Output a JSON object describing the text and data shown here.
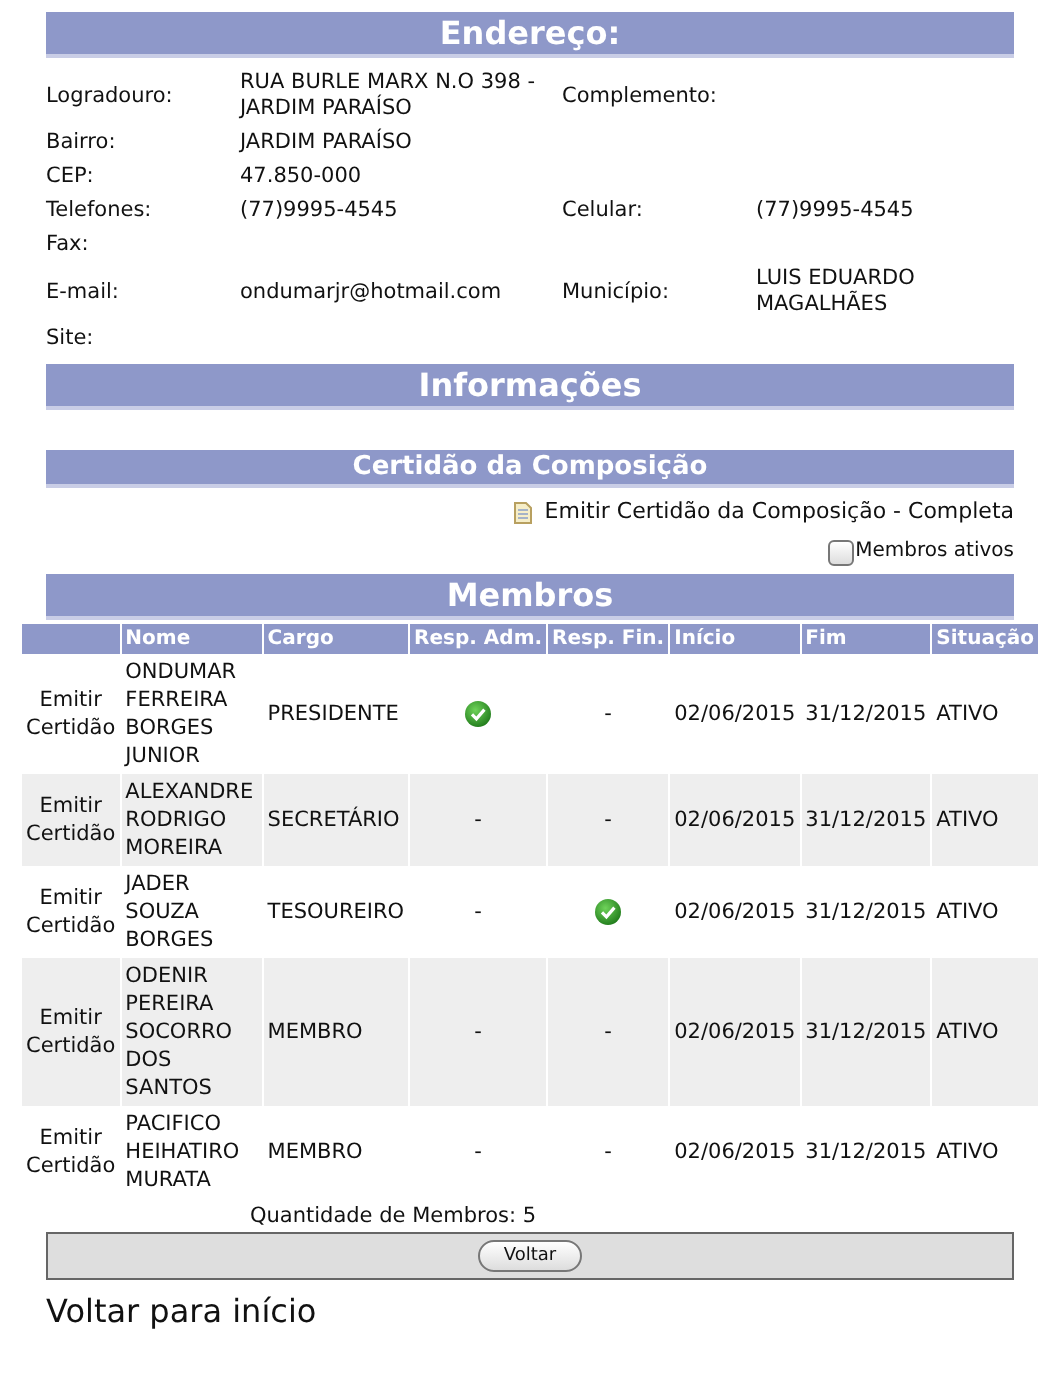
{
  "address": {
    "title": "Endereço:",
    "rows": [
      [
        {
          "label": "Logradouro:",
          "value": "RUA BURLE MARX N.O 398 - JARDIM PARAÍSO"
        },
        {
          "label": "Complemento:"
        }
      ],
      [
        {
          "label": "Bairro:",
          "value": "JARDIM PARAÍSO"
        }
      ],
      [
        {
          "label": "CEP:",
          "value": "47.850-000"
        }
      ],
      [
        {
          "label": "Telefones:",
          "value": "(77)9995-4545"
        },
        {
          "label": "Celular:",
          "value": "(77)9995-4545"
        }
      ],
      [
        {
          "label": "Fax:"
        }
      ],
      [
        {
          "label": "E-mail:",
          "value": "ondumarjr@hotmail.com"
        },
        {
          "label": "Município:",
          "value": "LUIS EDUARDO MAGALHÃES"
        }
      ],
      [
        {
          "label": "Site:"
        }
      ]
    ]
  },
  "info": {
    "title": "Informações"
  },
  "certidao": {
    "title": "Certidão da Composição",
    "link": "Emitir Certidão da Composição - Completa",
    "filter": {
      "label": "Membros ativos",
      "checked": false
    }
  },
  "members": {
    "title": "Membros",
    "columns": [
      "Nome",
      "Cargo",
      "Resp. Adm.",
      "Resp. Fin.",
      "Início",
      "Fim",
      "Situação"
    ],
    "rows": [
      {
        "action": "Emitir Certidão",
        "name": "ONDUMAR FERREIRA BORGES JUNIOR",
        "role": "PRESIDENTE",
        "adm": {
          "kind": "check"
        },
        "fin": {
          "kind": "text",
          "text": "-"
        },
        "start": "02/06/2015",
        "end": "31/12/2015",
        "status": "ATIVO"
      },
      {
        "action": "Emitir Certidão",
        "name": "ALEXANDRE RODRIGO MOREIRA",
        "role": "SECRETÁRIO",
        "adm": {
          "kind": "text",
          "text": "-"
        },
        "fin": {
          "kind": "text",
          "text": "-"
        },
        "start": "02/06/2015",
        "end": "31/12/2015",
        "status": "ATIVO"
      },
      {
        "action": "Emitir Certidão",
        "name": "JADER SOUZA BORGES",
        "role": "TESOUREIRO",
        "adm": {
          "kind": "text",
          "text": "-"
        },
        "fin": {
          "kind": "check"
        },
        "start": "02/06/2015",
        "end": "31/12/2015",
        "status": "ATIVO"
      },
      {
        "action": "Emitir Certidão",
        "name": "ODENIR PEREIRA SOCORRO DOS SANTOS",
        "role": "MEMBRO",
        "adm": {
          "kind": "text",
          "text": "-"
        },
        "fin": {
          "kind": "text",
          "text": "-"
        },
        "start": "02/06/2015",
        "end": "31/12/2015",
        "status": "ATIVO"
      },
      {
        "action": "Emitir Certidão",
        "name": "PACIFICO HEIHATIRO MURATA",
        "role": "MEMBRO",
        "adm": {
          "kind": "text",
          "text": "-"
        },
        "fin": {
          "kind": "text",
          "text": "-"
        },
        "start": "02/06/2015",
        "end": "31/12/2015",
        "status": "ATIVO"
      }
    ],
    "count": "Quantidade de Membros: 5"
  },
  "back_button": "Voltar",
  "home_link": "Voltar para início"
}
